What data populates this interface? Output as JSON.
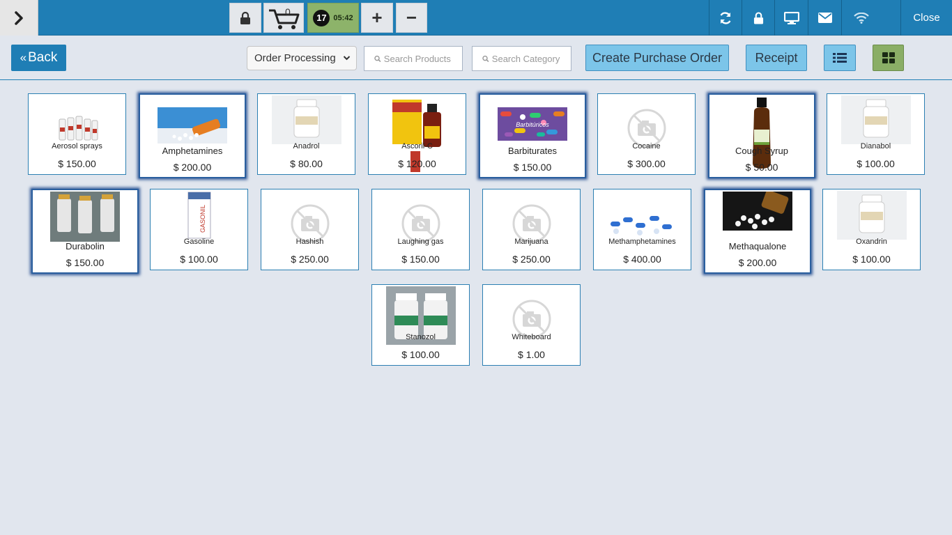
{
  "topbar": {
    "cart_count": "0",
    "timer_count": "17",
    "timer_time": "05:42",
    "plus_label": "+",
    "minus_label": "−",
    "close_label": "Close"
  },
  "toolbar": {
    "back_label": "Back",
    "status_value": "Order Processing",
    "search_products_placeholder": "Search Products",
    "search_category_placeholder": "Search Category",
    "create_po_label": "Create Purchase Order",
    "receipt_label": "Receipt"
  },
  "colors": {
    "accent": "#1f7eb5",
    "light_button": "#7cc5e9",
    "active_green": "#8aae66",
    "background": "#e1e6ee"
  },
  "products": [
    {
      "name": "Aerosol sprays",
      "price": "$ 150.00",
      "image": "spray-bottles"
    },
    {
      "name": "Amphetamines",
      "price": "$ 200.00",
      "image": "pills-spilled"
    },
    {
      "name": "Anadrol",
      "price": "$ 80.00",
      "image": "white-pill-bottle"
    },
    {
      "name": "Ascoril-C",
      "price": "$ 120.00",
      "image": "syrup-box"
    },
    {
      "name": "Barbiturates",
      "price": "$ 150.00",
      "image": "colorful-capsules"
    },
    {
      "name": "Cocaine",
      "price": "$ 300.00",
      "image": "no-image"
    },
    {
      "name": "Cough Syrup",
      "price": "$ 50.00",
      "image": "brown-bottle"
    },
    {
      "name": "Dianabol",
      "price": "$ 100.00",
      "image": "white-pill-bottle"
    },
    {
      "name": "Durabolin",
      "price": "$ 150.00",
      "image": "vials"
    },
    {
      "name": "Gasoline",
      "price": "$ 100.00",
      "image": "medicine-box"
    },
    {
      "name": "Hashish",
      "price": "$ 250.00",
      "image": "no-image"
    },
    {
      "name": "Laughing gas",
      "price": "$ 150.00",
      "image": "no-image"
    },
    {
      "name": "Marijuana",
      "price": "$ 250.00",
      "image": "no-image"
    },
    {
      "name": "Methamphetamines",
      "price": "$ 400.00",
      "image": "blue-pills"
    },
    {
      "name": "Methaqualone",
      "price": "$ 200.00",
      "image": "pills-spilled-dark"
    },
    {
      "name": "Oxandrin",
      "price": "$ 100.00",
      "image": "white-pill-bottle"
    },
    {
      "name": "Stanozol",
      "price": "$ 100.00",
      "image": "two-bottles"
    },
    {
      "name": "Whiteboard",
      "price": "$ 1.00",
      "image": "no-image"
    }
  ]
}
